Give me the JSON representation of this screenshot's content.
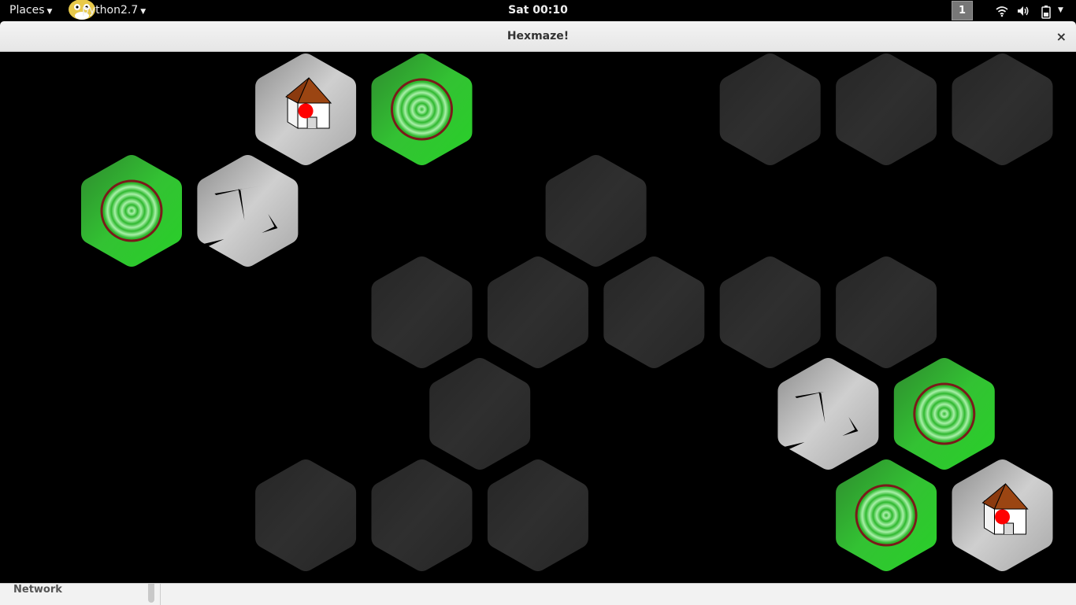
{
  "panel": {
    "places_label": "Places",
    "app_label": "python2.7",
    "clock": "Sat 00:10",
    "workspace": "1",
    "tray": [
      "wifi-icon",
      "volume-icon",
      "battery-icon"
    ]
  },
  "window": {
    "title": "Hexmaze!",
    "close_label": "×"
  },
  "colors": {
    "tile_dark": "#2b2b2b",
    "tile_light": "#bdbdbd",
    "tile_green": "#2fc02f",
    "target_ring": "#7a1a1a",
    "player": "#ff0000",
    "roof": "#8b3a0f"
  },
  "board": {
    "tiles": [
      {
        "col": 1,
        "row": 0,
        "kind": "home"
      },
      {
        "col": 2,
        "row": 0,
        "kind": "target"
      },
      {
        "col": 5,
        "row": 0,
        "kind": "empty"
      },
      {
        "col": 6,
        "row": 0,
        "kind": "empty"
      },
      {
        "col": 7,
        "row": 0,
        "kind": "empty"
      },
      {
        "col": 0,
        "row": 1,
        "kind": "target"
      },
      {
        "col": 1,
        "row": 1,
        "kind": "cracked"
      },
      {
        "col": 4,
        "row": 1,
        "kind": "empty"
      },
      {
        "col": 2,
        "row": 2,
        "kind": "empty"
      },
      {
        "col": 3,
        "row": 2,
        "kind": "empty"
      },
      {
        "col": 4,
        "row": 2,
        "kind": "empty"
      },
      {
        "col": 5,
        "row": 2,
        "kind": "empty"
      },
      {
        "col": 6,
        "row": 2,
        "kind": "empty"
      },
      {
        "col": 3,
        "row": 3,
        "kind": "empty"
      },
      {
        "col": 6,
        "row": 3,
        "kind": "cracked"
      },
      {
        "col": 7,
        "row": 3,
        "kind": "target"
      },
      {
        "col": 1,
        "row": 4,
        "kind": "empty"
      },
      {
        "col": 2,
        "row": 4,
        "kind": "empty"
      },
      {
        "col": 3,
        "row": 4,
        "kind": "empty"
      },
      {
        "col": 6,
        "row": 4,
        "kind": "target"
      },
      {
        "col": 7,
        "row": 4,
        "kind": "home"
      }
    ]
  },
  "sidebar": {
    "network_label": "Network"
  }
}
